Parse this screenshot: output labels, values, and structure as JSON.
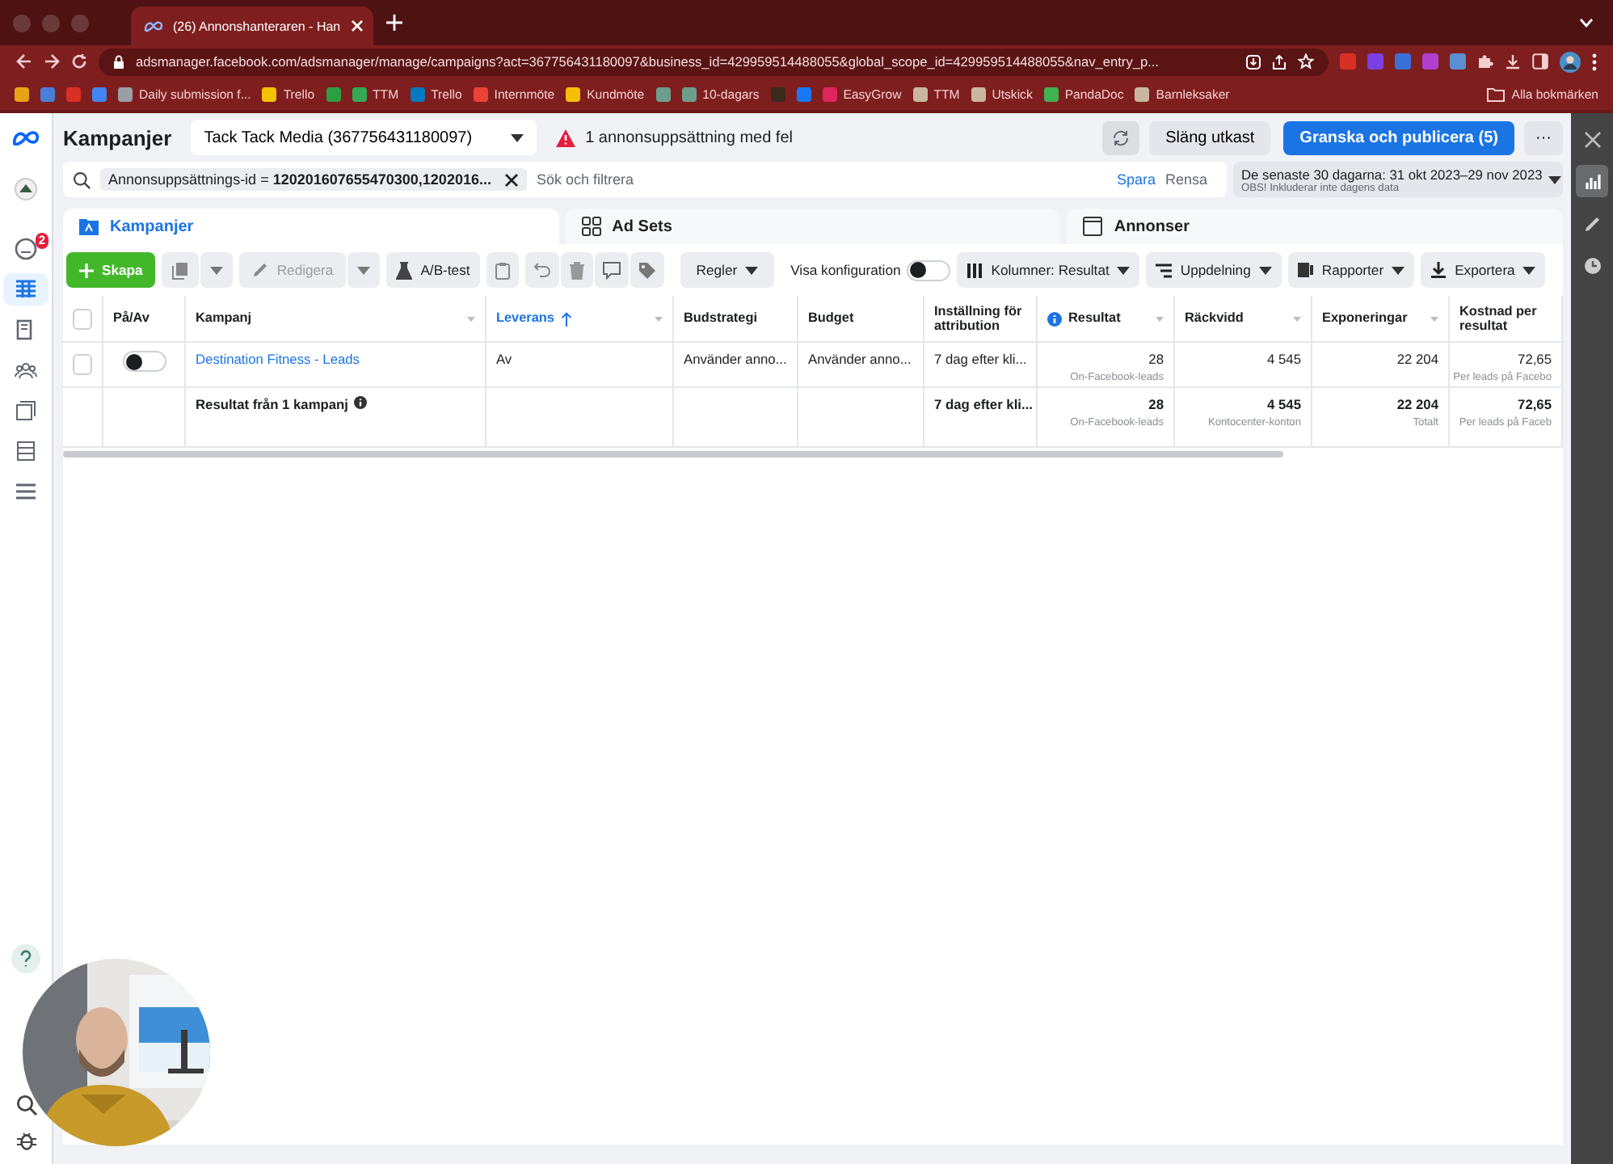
{
  "browser": {
    "tab_title": "(26) Annonshanteraren - Han",
    "url": "adsmanager.facebook.com/adsmanager/manage/campaigns?act=367756431180097&business_id=429959514488055&global_scope_id=429959514488055&nav_entry_p...",
    "extensions": [
      {
        "color": "#d93025"
      },
      {
        "color": "#7b3fe4"
      },
      {
        "color": "#3b6fd8"
      },
      {
        "color": "#b03fd0"
      },
      {
        "color": "#5a8fd0"
      }
    ],
    "bookmarks": [
      {
        "color": "#e8a317"
      },
      {
        "color": "#4a7fd8"
      },
      {
        "color": "#d93025"
      },
      {
        "color": "#4285f4"
      },
      {
        "label": "Daily submission f...",
        "color": "#9aa0a6"
      },
      {
        "label": "Trello",
        "color": "#f2c200"
      },
      {
        "color": "#2e9e44"
      },
      {
        "label": "TTM",
        "color": "#34a853"
      },
      {
        "label": "Trello",
        "color": "#0079bf"
      },
      {
        "label": "Internmöte",
        "color": "#ea4335"
      },
      {
        "label": "Kundmöte",
        "color": "#fbbc04"
      },
      {
        "color": "#6d9e8c"
      },
      {
        "label": "10-dagars",
        "color": "#6d9e8c"
      },
      {
        "color": "#3a2a1a"
      },
      {
        "color": "#1877f2"
      },
      {
        "label": "EasyGrow",
        "color": "#e0245e"
      },
      {
        "label": "TTM",
        "color": "#c9b6a0"
      },
      {
        "label": "Utskick",
        "color": "#c9b6a0"
      },
      {
        "label": "PandaDoc",
        "color": "#3fb34f"
      },
      {
        "label": "Barnleksaker",
        "color": "#c9b6a0"
      }
    ],
    "all_bookmarks": "Alla bokmärken"
  },
  "nav_items": [
    {
      "selected": false
    },
    {
      "selected": false,
      "badge": "2"
    },
    {
      "selected": true
    },
    {
      "selected": false
    },
    {
      "selected": false
    },
    {
      "selected": false
    },
    {
      "selected": false
    },
    {
      "selected": false
    }
  ],
  "header": {
    "title": "Kampanjer",
    "account": "Tack Tack Media (367756431180097)",
    "warning": "1 annonsuppsättning med fel",
    "discard": "Släng utkast",
    "publish": "Granska och publicera (5)",
    "more": "···"
  },
  "search": {
    "filter": "Annonsuppsättnings-id = **120201607655470300,1202016...**",
    "placeholder": "Sök och filtrera",
    "save": "Spara",
    "clear": "Rensa",
    "date_range": "De senaste 30 dagarna: 31 okt 2023–29 nov 2023",
    "date_note": "OBS! Inkluderar inte dagens data"
  },
  "tabs": [
    {
      "label": "Kampanjer",
      "selected": true
    },
    {
      "label": "Ad Sets",
      "selected": false
    },
    {
      "label": "Annonser",
      "selected": false
    }
  ],
  "toolbar": {
    "create": "Skapa",
    "edit": {
      "label": "Redigera",
      "disabled": true
    },
    "ab_test": "A/B-test",
    "rules": "Regler",
    "config": {
      "label": "Visa konfiguration",
      "on": false
    },
    "columns": "Kolumner: Resultat",
    "breakdown": "Uppdelning",
    "reports": "Rapporter",
    "export": "Exportera"
  },
  "table": {
    "all_checked": false,
    "columns": [
      {
        "label": "På/Av",
        "sorted": false,
        "menu": false,
        "info": false
      },
      {
        "label": "Kampanj",
        "sorted": false,
        "menu": true,
        "info": false
      },
      {
        "label": "Leverans",
        "sorted": true,
        "menu": true,
        "info": false
      },
      {
        "label": "Budstrategi",
        "sorted": false,
        "menu": false,
        "info": false
      },
      {
        "label": "Budget",
        "sorted": false,
        "menu": false,
        "info": false
      },
      {
        "label": "Inställning för attribution",
        "sorted": false,
        "menu": false,
        "info": false
      },
      {
        "label": "Resultat",
        "sorted": false,
        "menu": true,
        "info": true
      },
      {
        "label": "Räckvidd",
        "sorted": false,
        "menu": true,
        "info": false
      },
      {
        "label": "Exponeringar",
        "sorted": false,
        "menu": true,
        "info": false
      },
      {
        "label": "Kostnad per resultat",
        "sorted": false,
        "menu": false,
        "info": false
      }
    ],
    "rows": [
      {
        "kind": "campaign",
        "checked": false,
        "cells": [
          {
            "on": false
          },
          {
            "text": "Destination Fitness - Leads"
          },
          {
            "text": "Av"
          },
          {
            "text": "Använder anno..."
          },
          {
            "text": "Använder anno..."
          },
          {
            "text": "7 dag efter kli..."
          },
          {
            "text": "28",
            "sub": "On-Facebook-leads"
          },
          {
            "text": "4 545"
          },
          {
            "text": "22 204"
          },
          {
            "text": "72,65",
            "sub": "Per leads på Facebo"
          }
        ]
      },
      {
        "kind": "summary",
        "cells": [
          {
            "text": ""
          },
          {
            "text": "Resultat från 1 kampanj"
          },
          {
            "text": ""
          },
          {
            "text": ""
          },
          {
            "text": ""
          },
          {
            "text": "7 dag efter kli..."
          },
          {
            "text": "28",
            "sub": "On-Facebook-leads"
          },
          {
            "text": "4 545",
            "sub": "Kontocenter-konton"
          },
          {
            "text": "22 204",
            "sub": "Totalt"
          },
          {
            "text": "72,65",
            "sub": "Per leads på Faceb"
          }
        ]
      }
    ]
  },
  "side_tools": [
    {
      "selected": false
    },
    {
      "selected": true
    },
    {
      "selected": false
    },
    {
      "selected": false
    }
  ]
}
